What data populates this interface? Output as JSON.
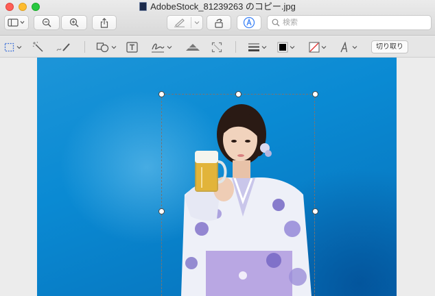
{
  "window": {
    "title": "AdobeStock_81239263 のコピー.jpg"
  },
  "toolbar": {
    "search_placeholder": "検索",
    "buttons": [
      "sidebar-toggle",
      "zoom-out",
      "zoom-in",
      "share",
      "highlight",
      "rotate",
      "markup"
    ]
  },
  "markup": {
    "crop_label": "切り取り",
    "tools": [
      "rectangular-selection",
      "instant-alpha",
      "sketch",
      "shapes",
      "text",
      "sign",
      "adjust-color",
      "adjust-size",
      "shape-style",
      "border-color",
      "fill-color",
      "text-style"
    ]
  },
  "colors": {
    "accent": "#3b82f6",
    "photo_background": "#0a8ad3"
  }
}
